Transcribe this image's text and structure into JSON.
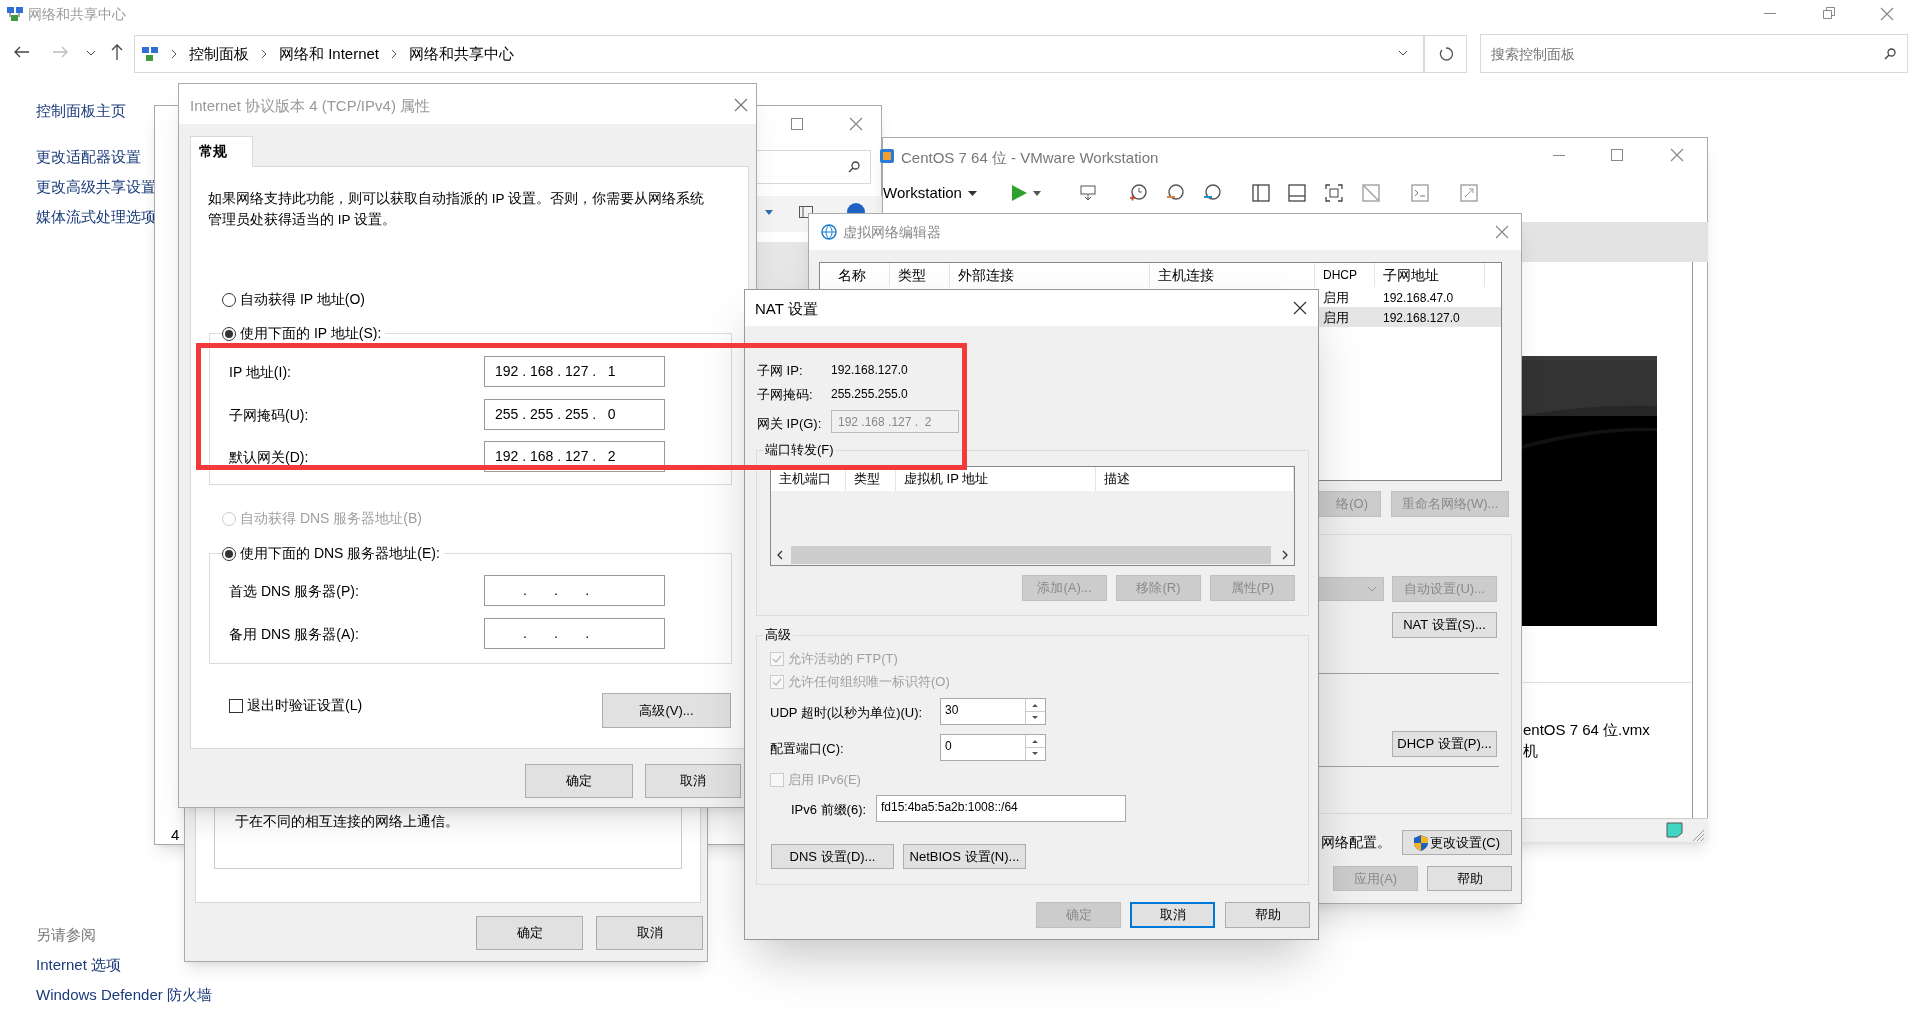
{
  "explorer": {
    "title": "网络和共享中心",
    "breadcrumb": [
      "控制面板",
      "网络和 Internet",
      "网络和共享中心"
    ],
    "search": {
      "placeholder": "搜索控制面板"
    },
    "sidebar_links": [
      "控制面板主页",
      "更改适配器设置",
      "更改高级共享设置",
      "媒体流式处理选项"
    ],
    "see_also": {
      "heading": "另请参阅",
      "links": [
        "Internet 选项",
        "Windows Defender 防火墙"
      ]
    }
  },
  "background_window": {
    "text": "4"
  },
  "adapter_dialog": {
    "description": "于在不同的相互连接的网络上通信。",
    "buttons": [
      "确定",
      "取消"
    ]
  },
  "ipv4_dialog": {
    "title": "Internet 协议版本 4 (TCP/IPv4) 属性",
    "tabs": [
      {
        "label": "常规",
        "selected": true
      }
    ],
    "description": "如果网络支持此功能，则可以获取自动指派的 IP 设置。否则，你需要从网络系统管理员处获得适当的 IP 设置。",
    "ip_options": [
      {
        "label": "自动获得 IP 地址(O)",
        "selected": false,
        "disabled": false
      },
      {
        "label": "使用下面的 IP 地址(S):",
        "selected": true,
        "disabled": false
      }
    ],
    "ip_fields": [
      {
        "label": "IP 地址(I):",
        "value": "192 . 168 . 127 .   1"
      },
      {
        "label": "子网掩码(U):",
        "value": "255 . 255 . 255 .   0"
      },
      {
        "label": "默认网关(D):",
        "value": "192 . 168 . 127 .   2"
      }
    ],
    "dns_options": [
      {
        "label": "自动获得 DNS 服务器地址(B)",
        "selected": false,
        "disabled": true
      },
      {
        "label": "使用下面的 DNS 服务器地址(E):",
        "selected": true,
        "disabled": false
      }
    ],
    "dns_fields": [
      {
        "label": "首选 DNS 服务器(P):",
        "value": ".       .       ."
      },
      {
        "label": "备用 DNS 服务器(A):",
        "value": ".       .       ."
      }
    ],
    "validate_checkbox": {
      "label": "退出时验证设置(L)",
      "checked": false
    },
    "advanced_button": "高级(V)...",
    "buttons": [
      "确定",
      "取消"
    ]
  },
  "vmware": {
    "title": "CentOS 7 64 位 - VMware Workstation",
    "menu": "Workstation",
    "vm_file": "entOS 7 64 位.vmx",
    "vm_line_2": "机"
  },
  "network_editor": {
    "title": "虚拟网络编辑器",
    "columns": [
      "名称",
      "类型",
      "外部连接",
      "主机连接",
      "DHCP",
      "子网地址"
    ],
    "rows": [
      {
        "dhcp": "启用",
        "subnet": "192.168.47.0",
        "selected": false
      },
      {
        "dhcp": "启用",
        "subnet": "192.168.127.0",
        "selected": true
      }
    ],
    "network_buttons": [
      {
        "label": "络(O)",
        "disabled": true
      },
      {
        "label": "重命名网络(W)...",
        "disabled": true
      }
    ],
    "settings_buttons": [
      {
        "label": "自动设置(U)...",
        "disabled": true
      },
      {
        "label": "NAT 设置(S)...",
        "disabled": false
      },
      {
        "label": "DHCP 设置(P)...",
        "disabled": false
      }
    ],
    "admin_note": "网络配置。",
    "change_button": "更改设置(C)",
    "footer_buttons": [
      {
        "label": "应用(A)",
        "disabled": true
      },
      {
        "label": "帮助",
        "disabled": false
      }
    ]
  },
  "nat_dialog": {
    "title": "NAT 设置",
    "info": [
      {
        "label": "子网 IP:",
        "value": "192.168.127.0"
      },
      {
        "label": "子网掩码:",
        "value": "255.255.255.0"
      }
    ],
    "gateway": {
      "label": "网关 IP(G):",
      "value": "192 .168 .127 .  2",
      "disabled": true
    },
    "port_forwarding": {
      "title": "端口转发(F)",
      "columns": [
        "主机端口",
        "类型",
        "虚拟机 IP 地址",
        "描述"
      ],
      "buttons": [
        {
          "label": "添加(A)...",
          "disabled": true
        },
        {
          "label": "移除(R)",
          "disabled": true
        },
        {
          "label": "属性(P)",
          "disabled": true
        }
      ]
    },
    "advanced": {
      "title": "高级",
      "checkboxes": [
        {
          "label": "允许活动的 FTP(T)",
          "checked": true,
          "disabled": true
        },
        {
          "label": "允许任何组织唯一标识符(O)",
          "checked": true,
          "disabled": true
        }
      ],
      "udp_timeout": {
        "label": "UDP 超时(以秒为单位)(U):",
        "value": "30"
      },
      "config_port": {
        "label": "配置端口(C):",
        "value": "0"
      },
      "ipv6_checkbox": {
        "label": "启用 IPv6(E)",
        "checked": false,
        "disabled": true
      },
      "ipv6_prefix": {
        "label": "IPv6 前缀(6):",
        "value": "fd15:4ba5:5a2b:1008::/64"
      },
      "buttons": [
        "DNS 设置(D)...",
        "NetBIOS 设置(N)..."
      ]
    },
    "buttons": [
      {
        "label": "确定",
        "disabled": true,
        "focused": false
      },
      {
        "label": "取消",
        "disabled": false,
        "focused": true
      },
      {
        "label": "帮助",
        "disabled": false,
        "focused": false
      }
    ]
  }
}
